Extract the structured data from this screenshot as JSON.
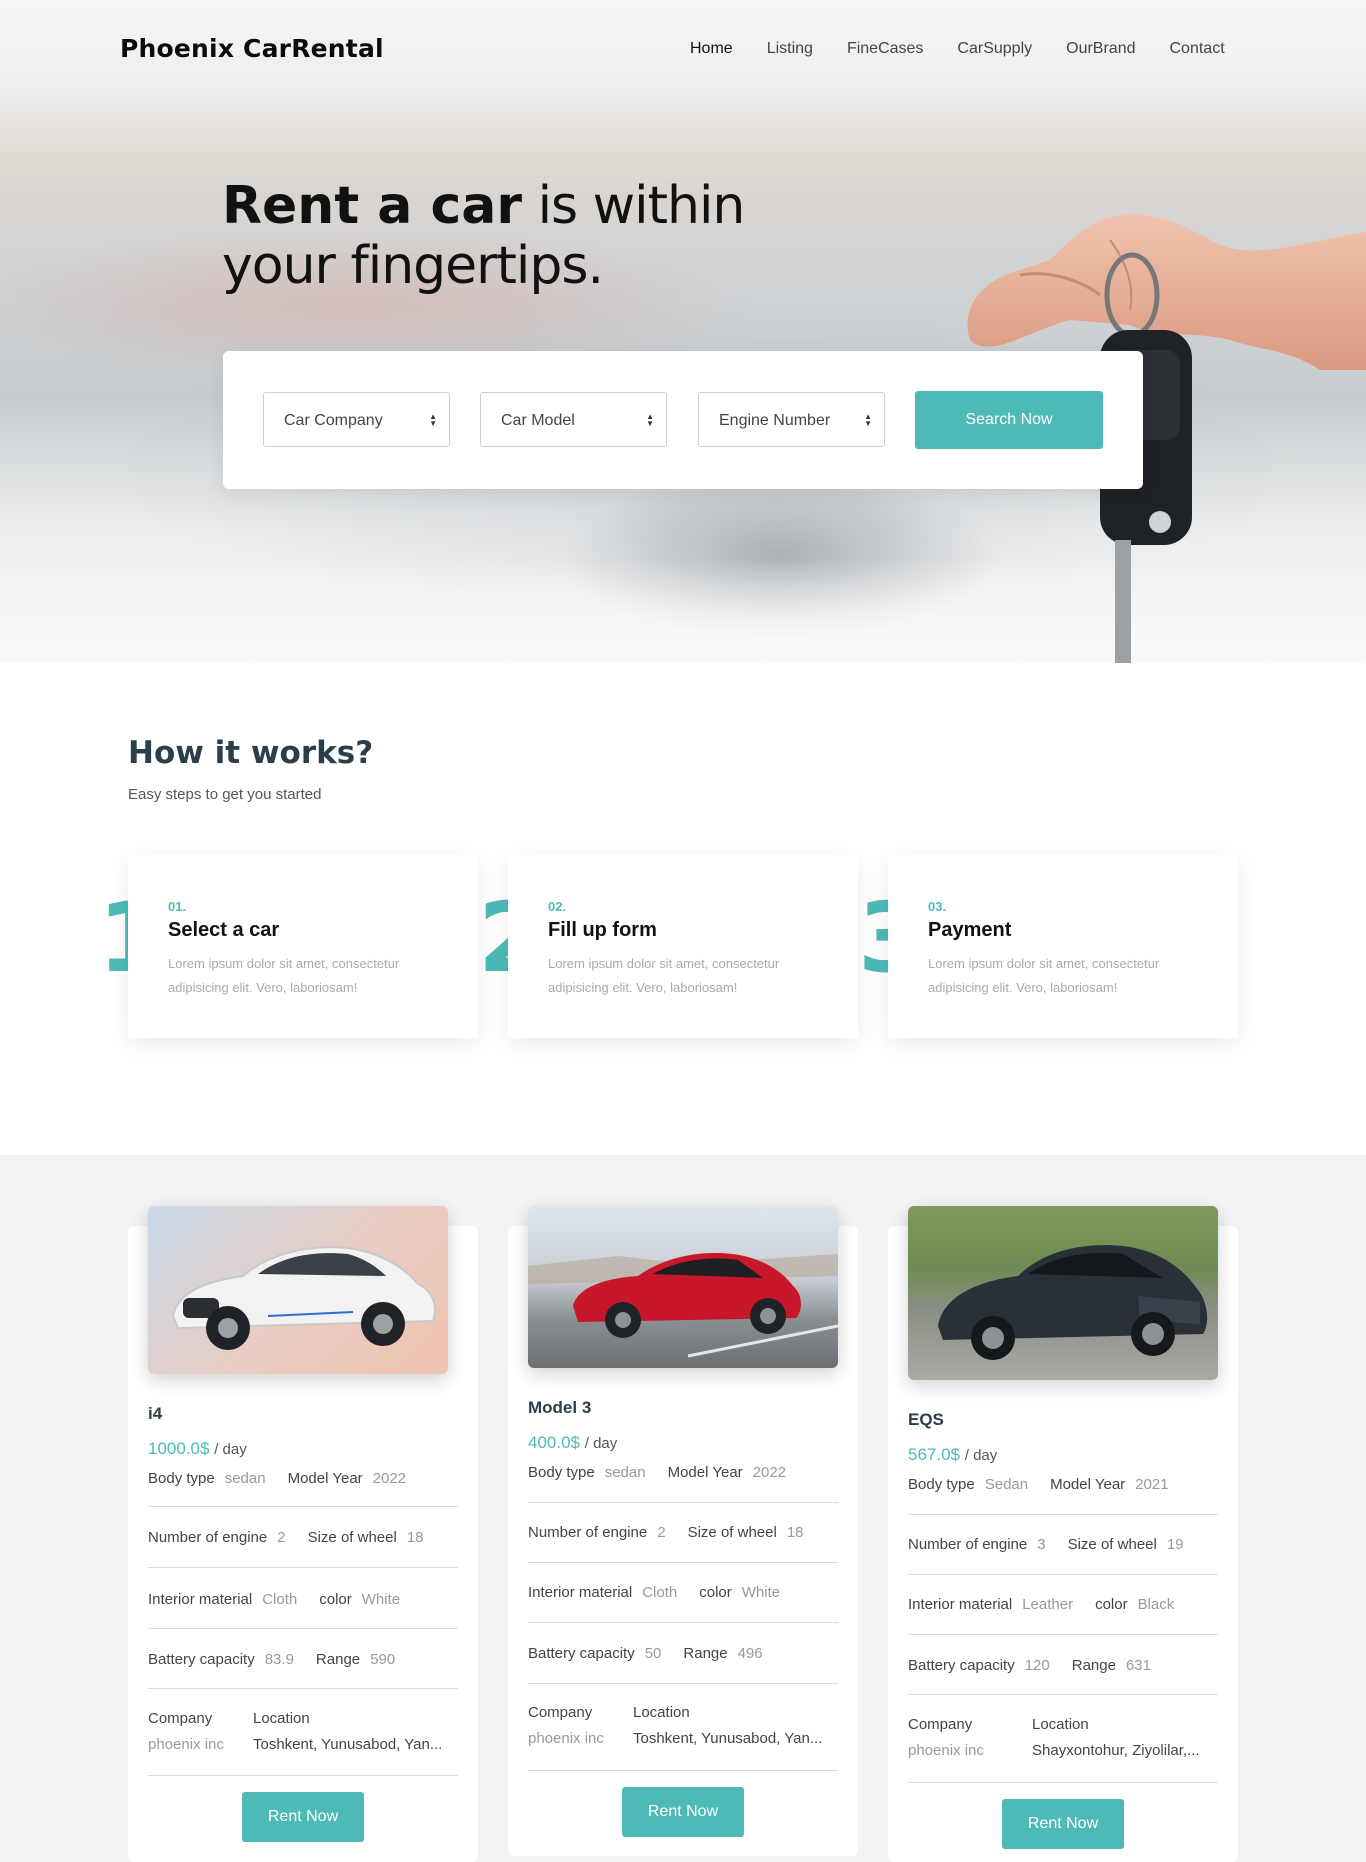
{
  "brand": {
    "logo": "Phoenix CarRental"
  },
  "nav": [
    {
      "label": "Home"
    },
    {
      "label": "Listing"
    },
    {
      "label": "FineCases"
    },
    {
      "label": "CarSupply"
    },
    {
      "label": "OurBrand"
    },
    {
      "label": "Contact"
    }
  ],
  "hero": {
    "headline_bold": "Rent a car",
    "headline_rest": " is within",
    "headline_line2": "your fingertips."
  },
  "search": {
    "company_select": "Car Company",
    "model_select": "Car Model",
    "engine_select": "Engine Number",
    "button": "Search Now"
  },
  "how": {
    "title": "How it works?",
    "subtitle": "Easy steps to get you started",
    "steps": [
      {
        "big": "1",
        "num": "01.",
        "title": "Select a car",
        "text": "Lorem ipsum dolor sit amet, consectetur adipisicing elit. Vero, laboriosam!"
      },
      {
        "big": "2",
        "num": "02.",
        "title": "Fill up form",
        "text": "Lorem ipsum dolor sit amet, consectetur adipisicing elit. Vero, laboriosam!"
      },
      {
        "big": "3",
        "num": "03.",
        "title": "Payment",
        "text": "Lorem ipsum dolor sit amet, consectetur adipisicing elit. Vero, laboriosam!"
      }
    ]
  },
  "spec_labels": {
    "body_type": "Body type",
    "model_year": "Model Year",
    "engines": "Number of engine",
    "wheel": "Size of wheel",
    "interior": "Interior material",
    "color": "color",
    "battery": "Battery capacity",
    "range": "Range",
    "company": "Company",
    "location": "Location",
    "per_day": "/ day",
    "rent": "Rent Now"
  },
  "cars": [
    {
      "name": "i4",
      "price": "1000.0$",
      "body_type": "sedan",
      "model_year": "2022",
      "engines": "2",
      "wheel": "18",
      "interior": "Cloth",
      "color": "White",
      "battery": "83.9",
      "range": "590",
      "company": "phoenix inc",
      "location": "Toshkent, Yunusabod, Yan..."
    },
    {
      "name": "Model 3",
      "price": "400.0$",
      "body_type": "sedan",
      "model_year": "2022",
      "engines": "2",
      "wheel": "18",
      "interior": "Cloth",
      "color": "White",
      "battery": "50",
      "range": "496",
      "company": "phoenix inc",
      "location": "Toshkent, Yunusabod, Yan..."
    },
    {
      "name": "EQS",
      "price": "567.0$",
      "body_type": "Sedan",
      "model_year": "2021",
      "engines": "3",
      "wheel": "19",
      "interior": "Leather",
      "color": "Black",
      "battery": "120",
      "range": "631",
      "company": "phoenix inc",
      "location": "Shayxontohur, Ziyolilar,..."
    }
  ],
  "colors": {
    "accent": "#4dbab7",
    "heading": "#2a3f4a"
  }
}
